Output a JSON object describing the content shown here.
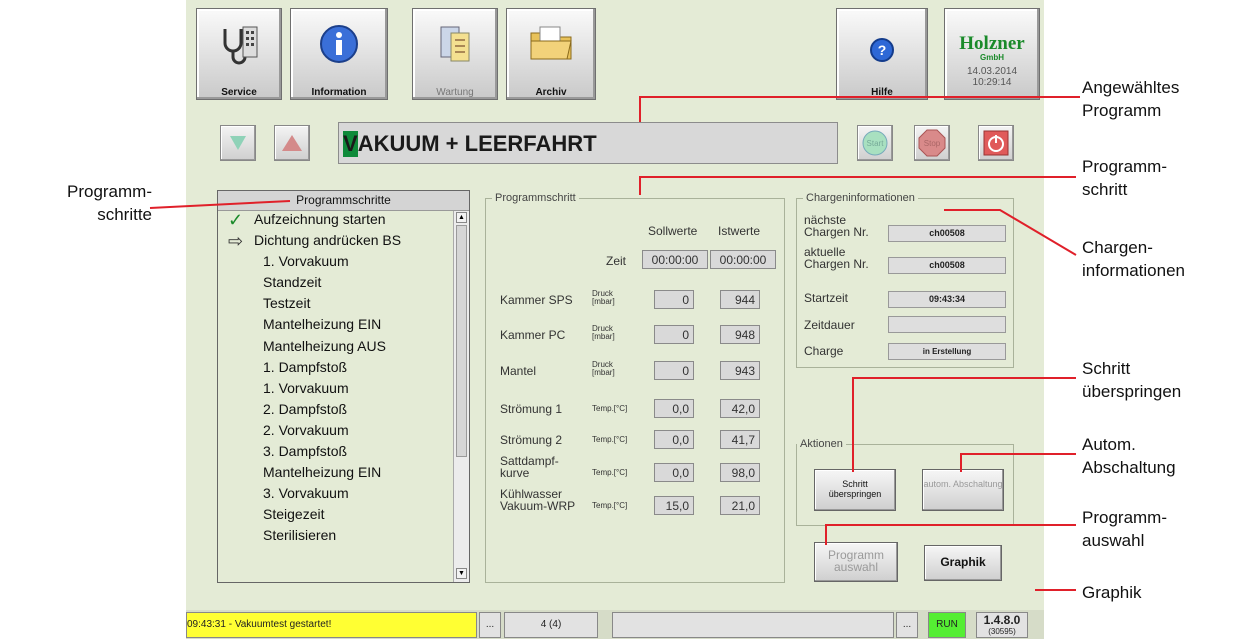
{
  "toolbar": {
    "service_label": "Service",
    "information_label": "Information",
    "wartung_label": "Wartung",
    "archiv_label": "Archiv",
    "hilfe_label": "Hilfe"
  },
  "logo": {
    "brand": "Holzner",
    "sub": "GmbH",
    "date": "14.03.2014",
    "time": "10:29:14"
  },
  "program": {
    "name_first": "V",
    "name_rest": "AKUUM + LEERFAHRT"
  },
  "controls": {
    "start_label": "Start",
    "stop_label": "Stop"
  },
  "steps": {
    "header": "Programmschritte",
    "items": [
      {
        "label": "Aufzeichnung starten",
        "marker": "✓"
      },
      {
        "label": "Dichtung andrücken BS",
        "marker": "⇨"
      },
      {
        "label": "1. Vorvakuum",
        "marker": ""
      },
      {
        "label": "Standzeit",
        "marker": ""
      },
      {
        "label": "Testzeit",
        "marker": ""
      },
      {
        "label": "Mantelheizung EIN",
        "marker": ""
      },
      {
        "label": "Mantelheizung AUS",
        "marker": ""
      },
      {
        "label": "1. Dampfstoß",
        "marker": ""
      },
      {
        "label": "1. Vorvakuum",
        "marker": ""
      },
      {
        "label": "2. Dampfstoß",
        "marker": ""
      },
      {
        "label": "2. Vorvakuum",
        "marker": ""
      },
      {
        "label": "3. Dampfstoß",
        "marker": ""
      },
      {
        "label": "Mantelheizung EIN",
        "marker": ""
      },
      {
        "label": "3. Vorvakuum",
        "marker": ""
      },
      {
        "label": "Steigezeit",
        "marker": ""
      },
      {
        "label": "Sterilisieren",
        "marker": ""
      }
    ]
  },
  "programmschritt": {
    "legend": "Programmschritt",
    "sollwerte": "Sollwerte",
    "istwerte": "Istwerte",
    "zeit_label": "Zeit",
    "zeit_soll": "00:00:00",
    "zeit_ist": "00:00:00",
    "rows": [
      {
        "name": "Kammer SPS",
        "unit": "Druck [mbar]",
        "soll": "0",
        "ist": "944"
      },
      {
        "name": "Kammer PC",
        "unit": "Druck [mbar]",
        "soll": "0",
        "ist": "948"
      },
      {
        "name": "Mantel",
        "unit": "Druck [mbar]",
        "soll": "0",
        "ist": "943"
      },
      {
        "name": "Strömung 1",
        "unit": "Temp.[°C]",
        "soll": "0,0",
        "ist": "42,0"
      },
      {
        "name": "Strömung 2",
        "unit": "Temp.[°C]",
        "soll": "0,0",
        "ist": "41,7"
      },
      {
        "name": "Sattdampf-kurve",
        "unit": "Temp.[°C]",
        "soll": "0,0",
        "ist": "98,0"
      },
      {
        "name": "Kühlwasser Vakuum-WRP",
        "unit": "Temp.[°C]",
        "soll": "15,0",
        "ist": "21,0"
      }
    ]
  },
  "charge": {
    "legend": "Chargeninformationen",
    "next_label": "nächste Chargen Nr.",
    "next_value": "ch00508",
    "current_label": "aktuelle Chargen Nr.",
    "current_value": "ch00508",
    "start_label": "Startzeit",
    "start_value": "09:43:34",
    "duration_label": "Zeitdauer",
    "duration_value": "",
    "charge_label": "Charge",
    "charge_value": "in Erstellung"
  },
  "aktionen": {
    "legend": "Aktionen",
    "skip_label": "Schritt überspringen",
    "auto_off_label": "autom. Abschaltung"
  },
  "buttons": {
    "programmauswahl": "Programm auswahl",
    "graphik": "Graphik"
  },
  "status": {
    "message": "09:43:31 - Vakuumtest gestartet!",
    "dots": "...",
    "count": "4 (4)",
    "dots2": "...",
    "run": "RUN",
    "version": "1.4.8.0",
    "build": "(30595)"
  },
  "callouts": {
    "angewaehltes": "Angewähltes Programm",
    "programmschritt": "Programm- schritt",
    "chargen": "Chargen- informationen",
    "schritt": "Schritt überspringen",
    "autom": "Autom. Abschaltung",
    "programmauswahl": "Programm- auswahl",
    "graphik": "Graphik",
    "programmschritte": "Programm- schritte"
  },
  "colors": {
    "panel": "#e4ebd6",
    "status_yellow": "#ffff33",
    "run_green": "#55ee33",
    "program_highlight": "#0f8a3a"
  }
}
